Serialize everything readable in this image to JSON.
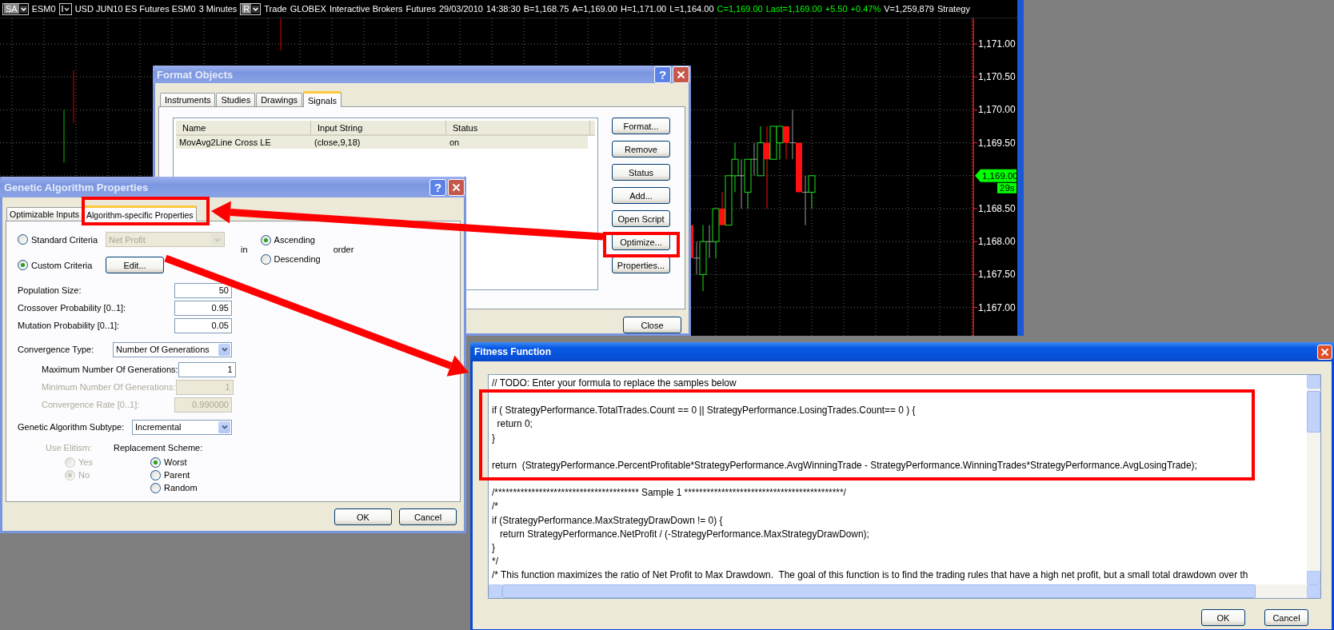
{
  "chart_window": {
    "toolbar": {
      "symbol_menu": "SA",
      "symbol": "ESM0",
      "description": "USD JUN10 ES Futures ESM0",
      "interval": "3 Minutes",
      "mode_menu": "R",
      "info": [
        "Trade",
        "GLOBEX",
        "Interactive Brokers",
        "Futures",
        "29/03/2010",
        "14:38:30"
      ],
      "quotes": [
        {
          "text": "B=1,168.75",
          "color": "#ffffff"
        },
        {
          "text": "A=1,169.00",
          "color": "#ffffff"
        },
        {
          "text": "H=1,171.00",
          "color": "#ffffff"
        },
        {
          "text": "L=1,164.00",
          "color": "#ffffff"
        },
        {
          "text": "C=1,169.00",
          "color": "#00ff00"
        },
        {
          "text": "Last=1,169.00",
          "color": "#00ff00"
        },
        {
          "text": "+5.50",
          "color": "#00ff00"
        },
        {
          "text": "+0.47%",
          "color": "#00ff00"
        },
        {
          "text": "V=1,259,879",
          "color": "#ffffff"
        }
      ],
      "trailing": "Strategy"
    },
    "price_axis": [
      "1,171.00",
      "1,170.50",
      "1,170.00",
      "1,169.50",
      "1,168.50",
      "1,168.00",
      "1,167.50",
      "1,167.00"
    ],
    "last_price": "1,169.00",
    "countdown": "29s"
  },
  "format_objects": {
    "title": "Format Objects",
    "active": false,
    "help": "?",
    "tabs": [
      {
        "label": "Instruments",
        "selected": false
      },
      {
        "label": "Studies",
        "selected": false
      },
      {
        "label": "Drawings",
        "selected": false
      },
      {
        "label": "Signals",
        "selected": true
      }
    ],
    "table": {
      "columns": [
        "Name",
        "Input String",
        "Status"
      ],
      "rows": [
        {
          "cells": [
            "MovAvg2Line Cross LE",
            "(close,9,18)",
            "on"
          ],
          "selected": true
        }
      ]
    },
    "buttons": [
      "Format...",
      "Remove",
      "Status",
      "Add...",
      "Open Script",
      "Optimize...",
      "Properties..."
    ],
    "close_button": "Close"
  },
  "genetic_algorithm": {
    "title": "Genetic Algorithm Properties",
    "active": false,
    "help": "?",
    "tabs": [
      {
        "label": "Optimizable Inputs",
        "selected": false
      },
      {
        "label": "Algorithm-specific Properties",
        "selected": true
      }
    ],
    "criteria": [
      {
        "label": "Standard Criteria",
        "selected": false
      },
      {
        "label": "Custom Criteria",
        "selected": true
      }
    ],
    "criteria_dropdown": {
      "value": "Net Profit",
      "disabled": true
    },
    "edit_button": "Edit...",
    "order_prefix": "in",
    "order_suffix": "order",
    "order": [
      {
        "label": "Ascending",
        "selected": true
      },
      {
        "label": "Descending",
        "selected": false
      }
    ],
    "fields": [
      {
        "label": "Population Size:",
        "value": "50"
      },
      {
        "label": "Crossover Probability [0..1]:",
        "value": "0.95"
      },
      {
        "label": "Mutation Probability [0..1]:",
        "value": "0.05"
      }
    ],
    "convergence_type": {
      "label": "Convergence Type:",
      "value": "Number Of Generations"
    },
    "convergence_fields": [
      {
        "label": "Maximum Number Of Generations:",
        "value": "1",
        "disabled": false
      },
      {
        "label": "Minimum Number Of Generations:",
        "value": "1",
        "disabled": true
      },
      {
        "label": "Convergence Rate [0..1]:",
        "value": "0.990000",
        "disabled": true
      }
    ],
    "subtype": {
      "label": "Genetic Algorithm Subtype:",
      "value": "Incremental"
    },
    "elitism": {
      "label": "Use Elitism:",
      "disabled": true,
      "options": [
        {
          "label": "Yes",
          "selected": false
        },
        {
          "label": "No",
          "selected": true
        }
      ]
    },
    "replacement": {
      "label": "Replacement Scheme:",
      "options": [
        {
          "label": "Worst",
          "selected": true
        },
        {
          "label": "Parent",
          "selected": false
        },
        {
          "label": "Random",
          "selected": false
        }
      ]
    },
    "buttons": [
      "OK",
      "Cancel"
    ]
  },
  "fitness_function": {
    "title": "Fitness Function",
    "active": true,
    "code": "// TODO: Enter your formula to replace the samples below\n\nif ( StrategyPerformance.TotalTrades.Count == 0 || StrategyPerformance.LosingTrades.Count== 0 ) {\n  return 0;\n}\n\nreturn  (StrategyPerformance.PercentProfitable*StrategyPerformance.AvgWinningTrade - StrategyPerformance.WinningTrades*StrategyPerformance.AvgLosingTrade);\n\n/*************************************** Sample 1 *******************************************/\n/*\nif (StrategyPerformance.MaxStrategyDrawDown != 0) {\n   return StrategyPerformance.NetProfit / (-StrategyPerformance.MaxStrategyDrawDown);\n}\n*/\n/* This function maximizes the ratio of Net Profit to Max Drawdown.  The goal of this function is to find the trading rules that have a high net profit, but a small total drawdown over th",
    "buttons": [
      "OK",
      "Cancel"
    ]
  }
}
